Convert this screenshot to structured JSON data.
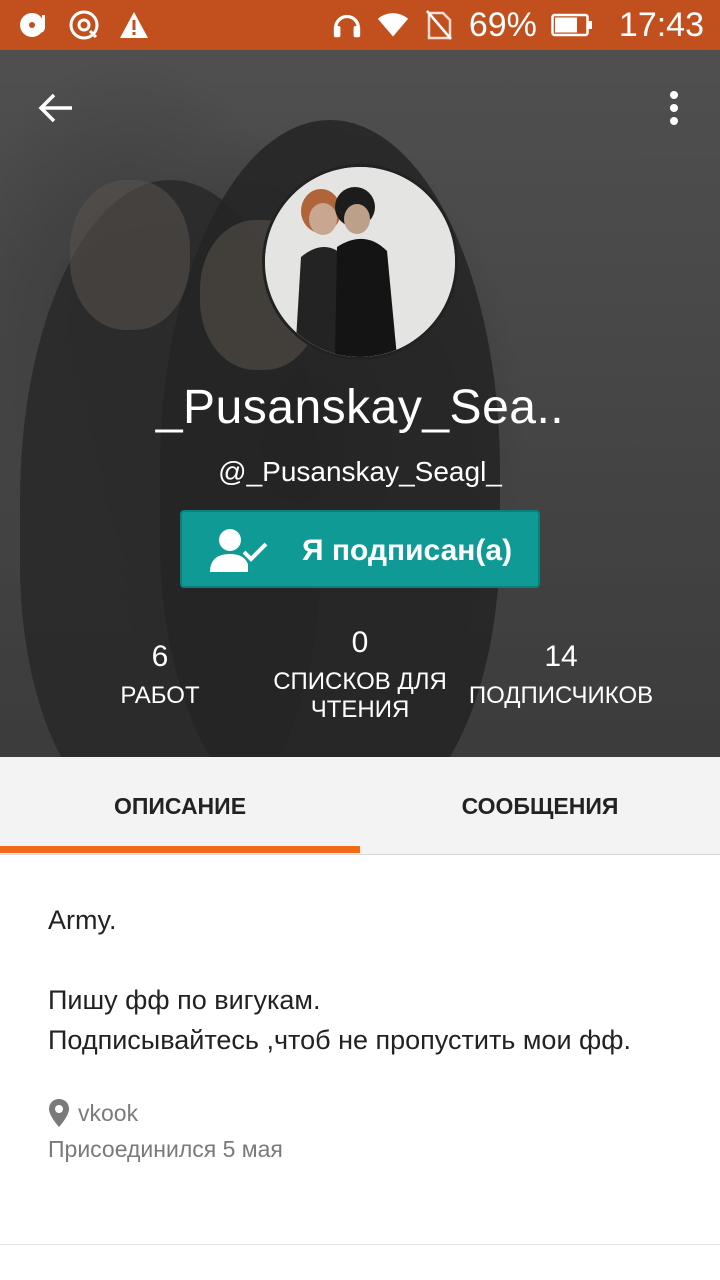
{
  "status_bar": {
    "battery_percent": "69%",
    "time": "17:43",
    "color": "#c2501e"
  },
  "profile": {
    "display_name": "_Pusanskay_Sea..",
    "username": "@_Pusanskay_Seagl_",
    "follow_button_label": "Я подписан(а)",
    "accent_color": "#0f9a96"
  },
  "stats": [
    {
      "value": "6",
      "label": "РАБОТ"
    },
    {
      "value": "0",
      "label": "СПИСКОВ ДЛЯ ЧТЕНИЯ"
    },
    {
      "value": "14",
      "label": "ПОДПИСЧИКОВ"
    }
  ],
  "tabs": [
    {
      "label": "ОПИСАНИЕ",
      "active": true
    },
    {
      "label": "СООБЩЕНИЯ",
      "active": false
    }
  ],
  "tab_indicator_color": "#f26a17",
  "description": {
    "lines": [
      "Army.",
      "",
      "Пишу фф по вигукам.",
      "Подписывайтесь ,чтоб не пропустить мои фф."
    ],
    "location": "vkook",
    "joined": "Присоединился 5 мая"
  },
  "icons": {
    "status_left": [
      "music-disc-icon",
      "sync-disc-icon",
      "warning-icon"
    ],
    "status_right": [
      "headset-icon",
      "wifi-icon",
      "no-sim-icon",
      "battery-icon"
    ],
    "header": [
      "back-arrow-icon",
      "more-vert-icon"
    ],
    "follow": "user-check-icon",
    "location": "location-pin-icon"
  }
}
